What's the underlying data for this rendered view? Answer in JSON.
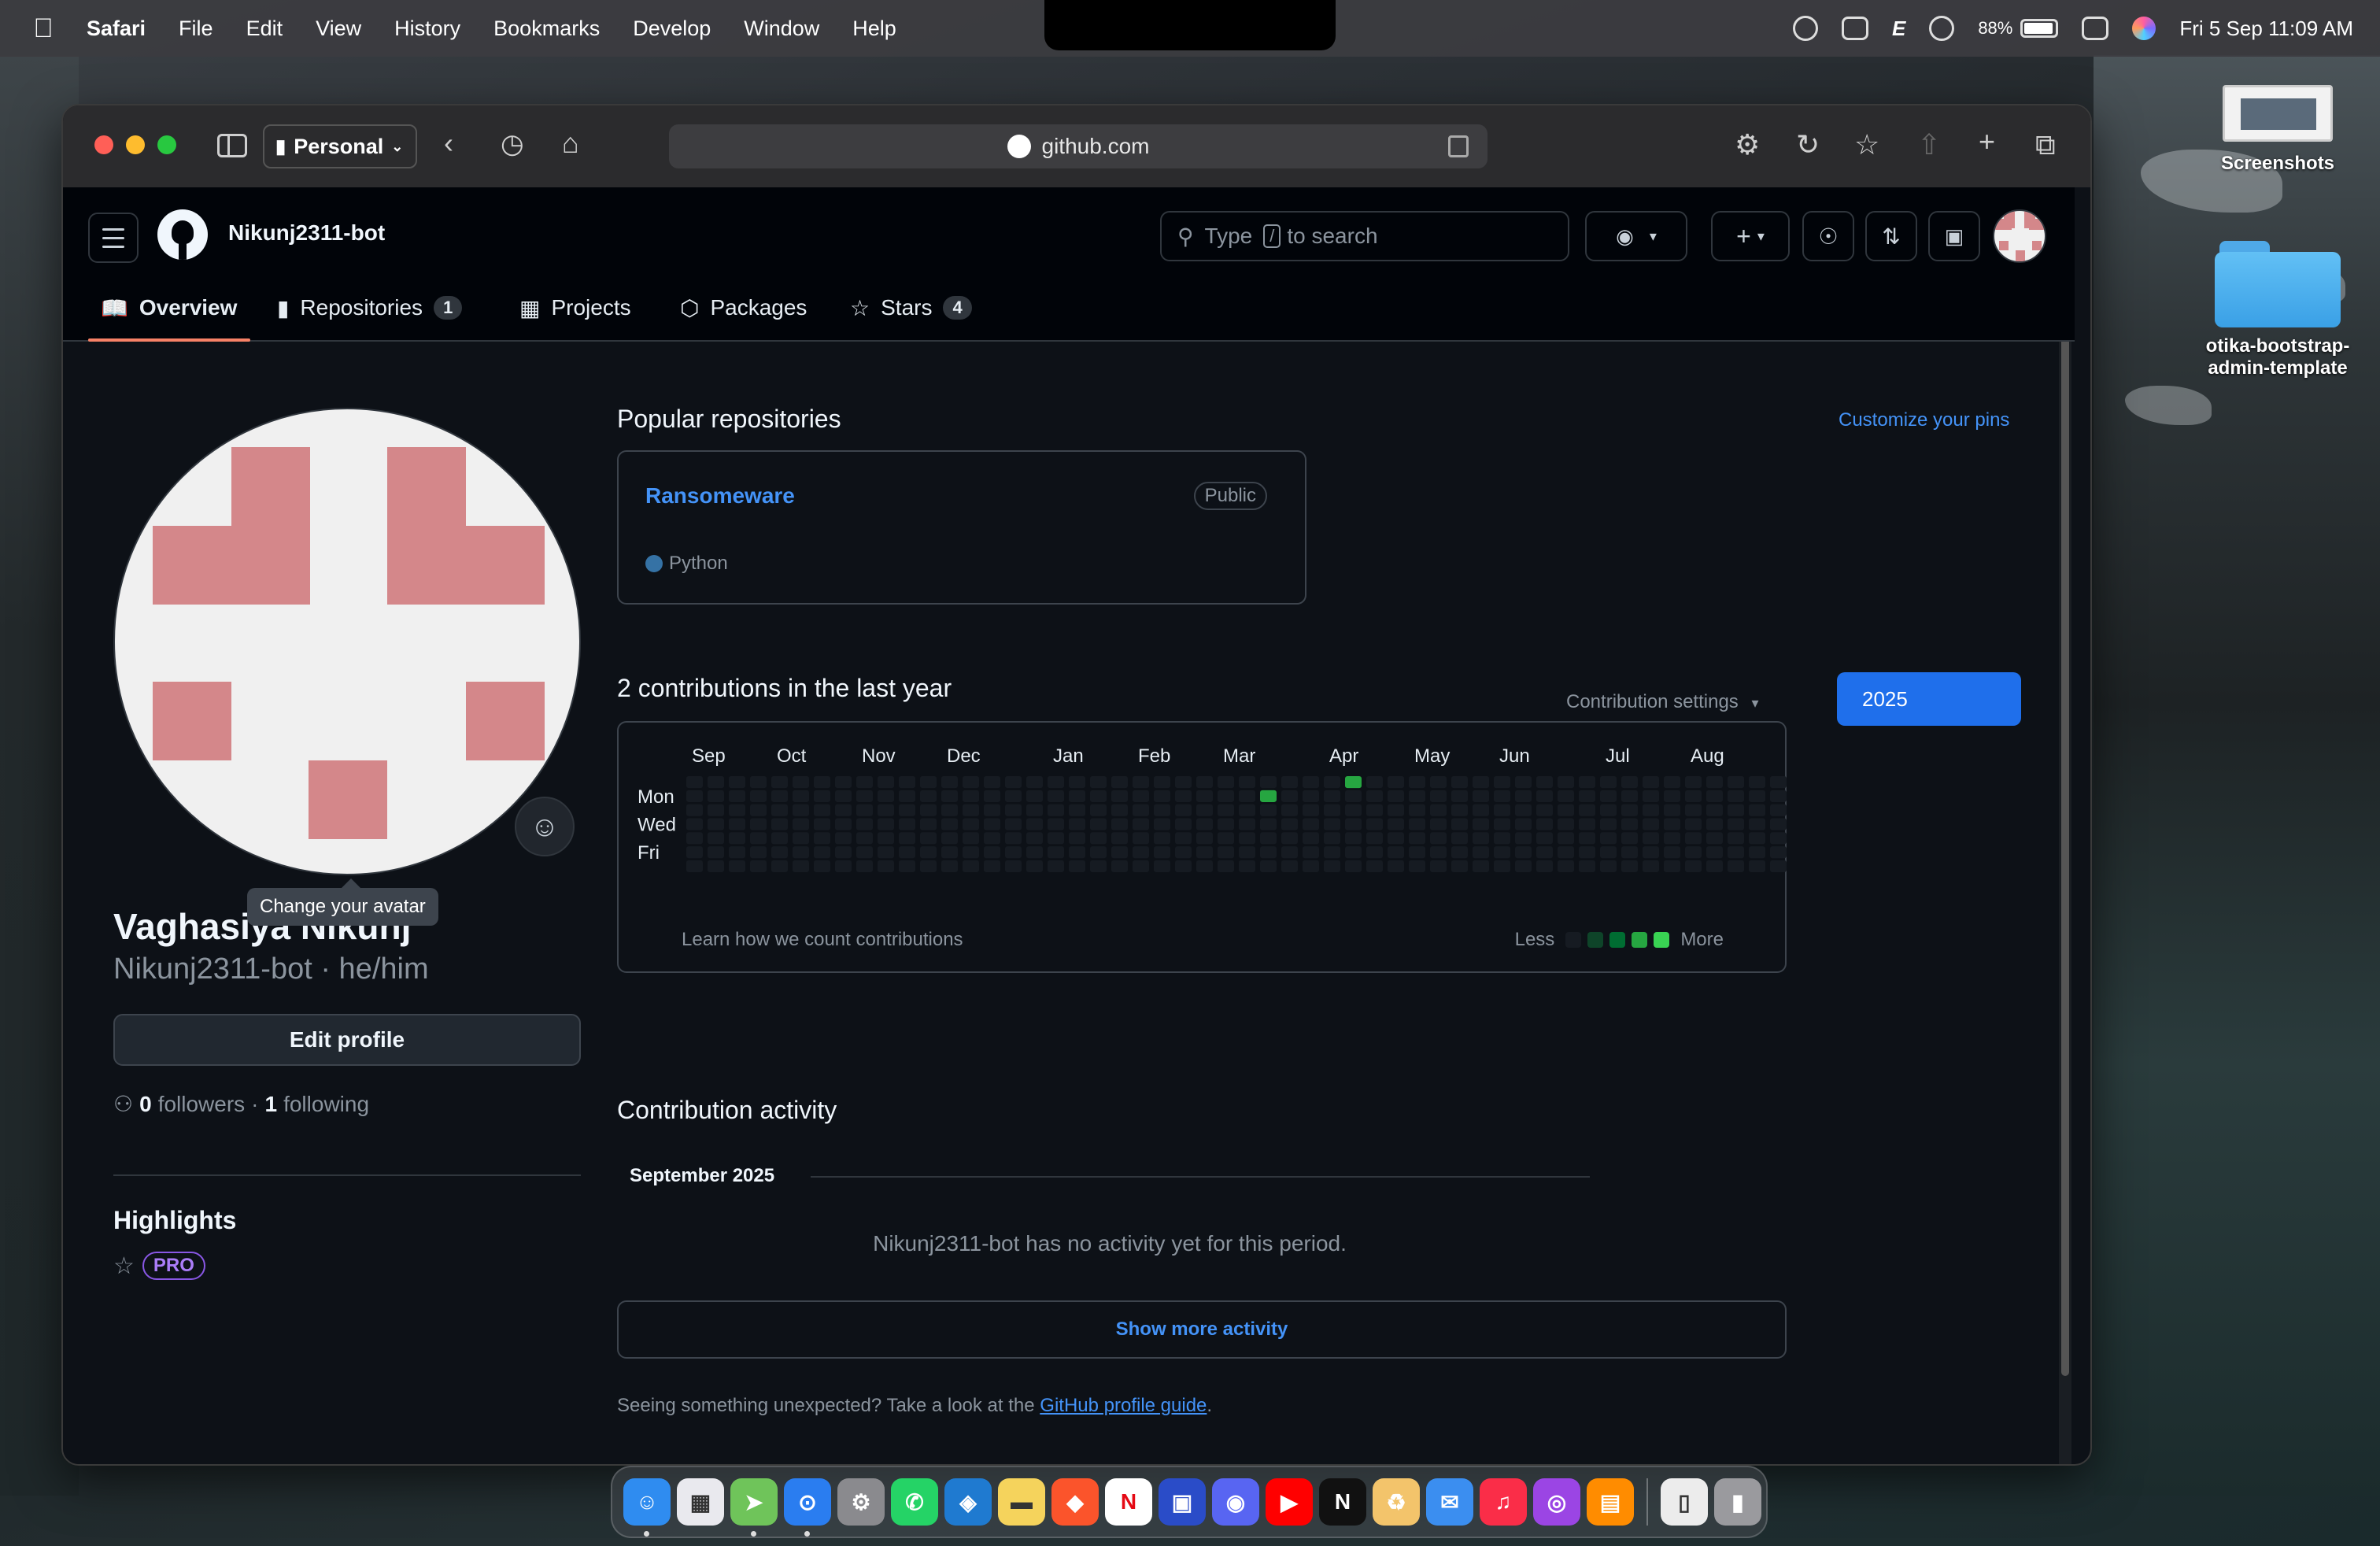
{
  "menubar": {
    "app_name": "Safari",
    "items": [
      "File",
      "Edit",
      "View",
      "History",
      "Bookmarks",
      "Develop",
      "Window",
      "Help"
    ],
    "battery_percent": "88%",
    "datetime": "Fri 5 Sep  11:09 AM"
  },
  "desktop": {
    "icons": [
      "Screenshots",
      "otika-bootstrap-admin-template"
    ]
  },
  "browser": {
    "profile": "Personal",
    "address": "github.com"
  },
  "github": {
    "header": {
      "username": "Nikunj2311-bot",
      "search_prefix": "Type",
      "search_key": "/",
      "search_suffix": "to search"
    },
    "tabs": [
      {
        "label": "Overview"
      },
      {
        "label": "Repositories",
        "count": "1"
      },
      {
        "label": "Projects"
      },
      {
        "label": "Packages"
      },
      {
        "label": "Stars",
        "count": "4"
      }
    ],
    "profile": {
      "tooltip": "Change your avatar",
      "name": "Vaghasiya Nikunj",
      "login_line": "Nikunj2311-bot · he/him",
      "edit_button": "Edit profile",
      "followers_count": "0",
      "followers_label": "followers",
      "following_count": "1",
      "following_label": "following",
      "highlights_title": "Highlights",
      "pro_badge": "PRO"
    },
    "popular": {
      "title": "Popular repositories",
      "customize": "Customize your pins",
      "repos": [
        {
          "name": "Ransomeware",
          "visibility": "Public",
          "language": "Python",
          "language_color": "#3572a5"
        }
      ]
    },
    "contributions": {
      "title": "2 contributions in the last year",
      "settings": "Contribution settings",
      "year": "2025",
      "months": [
        "Sep",
        "Oct",
        "Nov",
        "Dec",
        "Jan",
        "Feb",
        "Mar",
        "Apr",
        "May",
        "Jun",
        "Jul",
        "Aug"
      ],
      "days": [
        "Mon",
        "Wed",
        "Fri"
      ],
      "footer_link": "Learn how we count contributions",
      "legend_less": "Less",
      "legend_more": "More",
      "empty_color": "#161b22",
      "level_colors": [
        "#161b22",
        "#0e4429",
        "#006d32",
        "#26a641",
        "#39d353"
      ],
      "active_cells": [
        {
          "week": 27,
          "day": 1,
          "level": 3
        },
        {
          "week": 31,
          "day": 0,
          "level": 3
        }
      ]
    },
    "activity": {
      "title": "Contribution activity",
      "month": "September 2025",
      "empty_message": "Nikunj2311-bot has no activity yet for this period.",
      "show_more": "Show more activity",
      "guide_prefix": "Seeing something unexpected? Take a look at the",
      "guide_link": "GitHub profile guide",
      "guide_suffix": "."
    }
  },
  "dock": {
    "apps": [
      "Finder",
      "Launchpad",
      "Maps",
      "Safari",
      "Settings",
      "WhatsApp",
      "VS Code",
      "Notes",
      "Brave",
      "Netflix",
      "Screen",
      "Discord",
      "YouTube",
      "Netflix",
      "Recycle",
      "Mail",
      "Music",
      "Podcasts",
      "Books",
      "Document",
      "Trash"
    ]
  }
}
